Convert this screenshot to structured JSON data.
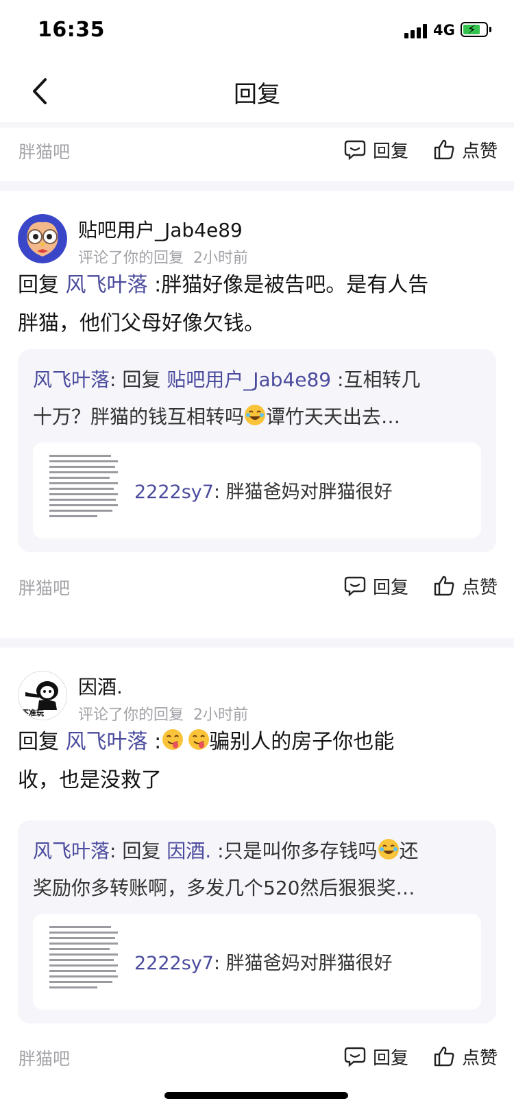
{
  "status_bar": {
    "time": "16:35",
    "network": "4G"
  },
  "nav": {
    "title": "回复"
  },
  "top_footer": {
    "forum": "胖猫吧",
    "reply": "回复",
    "like": "点赞"
  },
  "items": [
    {
      "username": "贴吧用户_Jab4e89",
      "action": "评论了你的回复",
      "time": "2小时前",
      "content_prefix": "回复",
      "mention": "风飞叶落",
      "content_line1": " :胖猫好像是被告吧。是有人告",
      "content_line2": "胖猫，他们父母好像欠钱。",
      "quote": {
        "author": "风飞叶落",
        "mid": ": 回复 ",
        "target": "贴吧用户_Jab4e89",
        "text1": " :互相转几",
        "line2_a": "十万？胖猫的钱互相转吗",
        "line2_b": "谭竹天天出去…"
      },
      "origin": {
        "author": "2222sy7",
        "text": ": 胖猫爸妈对胖猫很好"
      },
      "footer": {
        "forum": "胖猫吧",
        "reply": "回复",
        "like": "点赞"
      }
    },
    {
      "username": "因酒.",
      "action": "评论了你的回复",
      "time": "2小时前",
      "content_prefix": "回复",
      "mention": "风飞叶落",
      "content_line1_a": " :",
      "content_line1_b": "骗别人的房子你也能",
      "content_line2": "收，也是没救了",
      "avatar_caption": "不准玩",
      "quote": {
        "author": "风飞叶落",
        "mid": ": 回复 ",
        "target": "因酒.",
        "text1": " :只是叫你多存钱吗",
        "text1_b": "还",
        "line2": "奖励你多转账啊，多发几个520然后狠狠奖…"
      },
      "origin": {
        "author": "2222sy7",
        "text": ": 胖猫爸妈对胖猫很好"
      },
      "footer": {
        "forum": "胖猫吧",
        "reply": "回复",
        "like": "点赞"
      }
    }
  ],
  "colors": {
    "link": "#4b4b9e",
    "muted": "#a3a3a8",
    "quote_bg": "#f5f5fa"
  },
  "icons": [
    "back-icon",
    "comment-icon",
    "thumbs-up-icon",
    "laugh-cry-emoji",
    "tongue-emoji"
  ]
}
